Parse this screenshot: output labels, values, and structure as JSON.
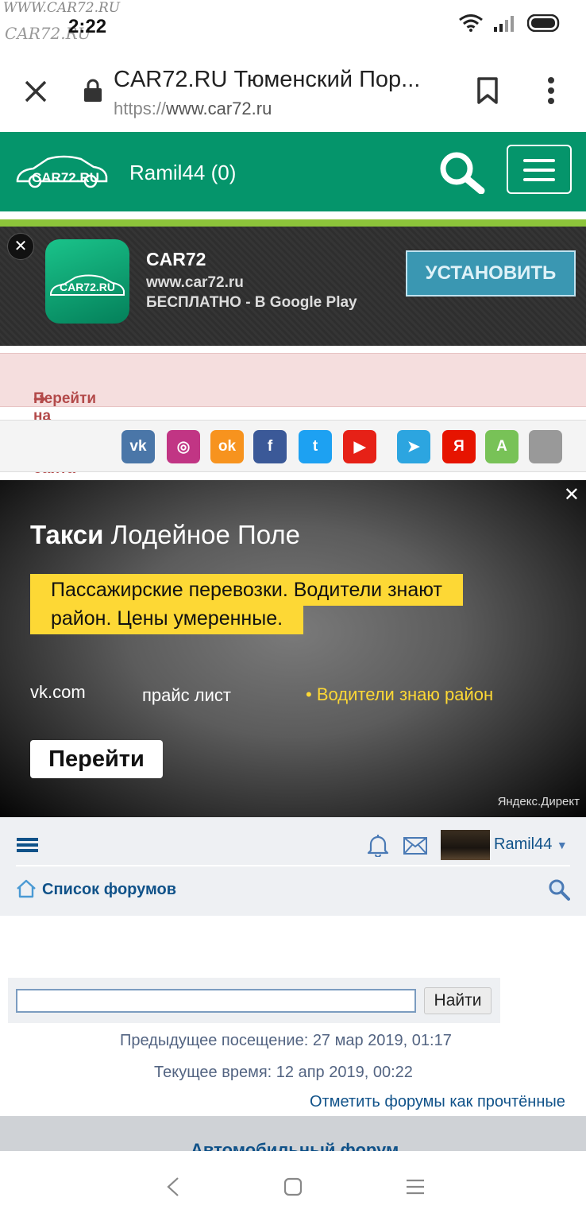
{
  "status_bar": {
    "watermark_top": "WWW.CAR72.RU",
    "watermark_logo": "CAR72.RU",
    "time": "2:22"
  },
  "browser": {
    "page_title": "CAR72.RU Тюменский Пор...",
    "url_protocol": "https://",
    "url_host": "www.car72.ru"
  },
  "site_header": {
    "logo_text": "CAR72.RU",
    "user_link": "Ramil44 (0)"
  },
  "app_banner": {
    "app_icon_text": "CAR72.RU",
    "app_name": "CAR72",
    "app_url": "www.car72.ru",
    "app_price": "БЕСПЛАТНО - В Google Play",
    "install_label": "УСТАНОВИТЬ",
    "close_glyph": "✕"
  },
  "full_version": {
    "label": "Перейти на полную версию сайта",
    "arrow_glyph": "➜"
  },
  "socials": [
    {
      "icon": "vk-icon",
      "text": "vk",
      "color": "#4a76a8"
    },
    {
      "icon": "instagram-icon",
      "text": "◎",
      "color": "#c13584"
    },
    {
      "icon": "odnoklassniki-icon",
      "text": "ok",
      "color": "#f7931e"
    },
    {
      "icon": "facebook-icon",
      "text": "f",
      "color": "#3b5998"
    },
    {
      "icon": "twitter-icon",
      "text": "t",
      "color": "#1da1f2"
    },
    {
      "icon": "youtube-icon",
      "text": "▶",
      "color": "#e62117"
    },
    {
      "icon": "telegram-icon",
      "text": "➤",
      "color": "#2ca5e0"
    },
    {
      "icon": "yandex-icon",
      "text": "Я",
      "color": "#e61400"
    },
    {
      "icon": "android-icon",
      "text": "A",
      "color": "#78c257"
    },
    {
      "icon": "apple-icon",
      "text": "",
      "color": "#999999"
    }
  ],
  "ad": {
    "close_glyph": "✕",
    "title_bold": "Такси",
    "title_rest": " Лодейное Поле",
    "text": "Пассажирские перевозки. Водители знают район. Цены умеренные.",
    "link1": "vk.com",
    "link2": "прайс лист",
    "link3": "• Водители знаю район",
    "go_label": "Перейти",
    "source": "Яндекс.Директ"
  },
  "forum_nav": {
    "username": "Ramil44",
    "caret": "▼",
    "forum_list_label": "Список форумов"
  },
  "search": {
    "input_value": "",
    "button_label": "Найти"
  },
  "info": {
    "last_visit": "Предыдущее посещение: 27 мар 2019, 01:17",
    "current_time": "Текущее время: 12 апр 2019, 00:22",
    "mark_read": "Отметить форумы как прочтённые"
  },
  "category_header": "Автомобильный форум",
  "colors": {
    "brand_green": "#05956b",
    "lime": "#8cc43a",
    "forum_blue": "#105289",
    "ad_yellow": "#fdd835"
  }
}
